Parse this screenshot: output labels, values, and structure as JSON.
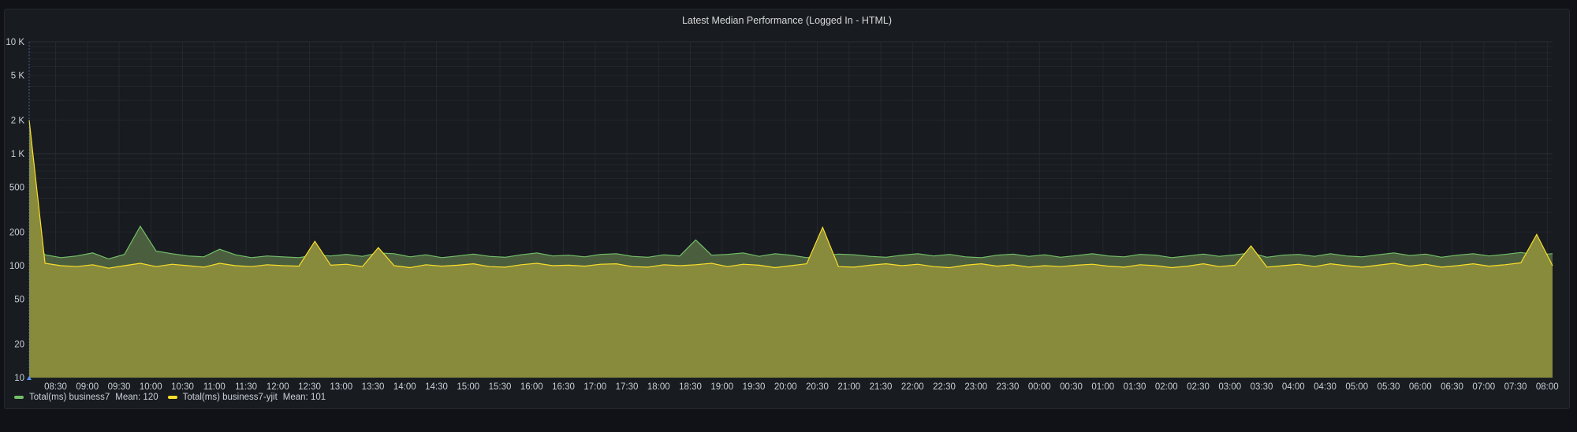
{
  "panel": {
    "title": "Latest Median Performance (Logged In - HTML)"
  },
  "chart_data": {
    "type": "area",
    "title": "Latest Median Performance (Logged In - HTML)",
    "y_scale": "log",
    "ylim": [
      10,
      10000
    ],
    "y_ticks": [
      10,
      20,
      50,
      100,
      200,
      500,
      1000,
      2000,
      5000,
      10000
    ],
    "y_tick_labels": [
      "10",
      "20",
      "50",
      "100",
      "200",
      "500",
      "1 K",
      "2 K",
      "5 K",
      "10 K"
    ],
    "xlim": [
      "08:05",
      "08:05"
    ],
    "x_tick_labels": [
      "08:30",
      "09:00",
      "09:30",
      "10:00",
      "10:30",
      "11:00",
      "11:30",
      "12:00",
      "12:30",
      "13:00",
      "13:30",
      "14:00",
      "14:30",
      "15:00",
      "15:30",
      "16:00",
      "16:30",
      "17:00",
      "17:30",
      "18:00",
      "18:30",
      "19:00",
      "19:30",
      "20:00",
      "20:30",
      "21:00",
      "21:30",
      "22:00",
      "22:30",
      "23:00",
      "23:30",
      "00:00",
      "00:30",
      "01:00",
      "01:30",
      "02:00",
      "02:30",
      "03:00",
      "03:30",
      "04:00",
      "04:30",
      "05:00",
      "05:30",
      "06:00",
      "06:30",
      "07:00",
      "07:30",
      "08:00"
    ],
    "grid": true,
    "legend_placement": "bottom-left",
    "x": [
      "08:05",
      "08:20",
      "08:35",
      "08:50",
      "09:05",
      "09:20",
      "09:35",
      "09:50",
      "10:05",
      "10:20",
      "10:35",
      "10:50",
      "11:05",
      "11:20",
      "11:35",
      "11:50",
      "12:05",
      "12:20",
      "12:35",
      "12:50",
      "13:05",
      "13:20",
      "13:35",
      "13:50",
      "14:05",
      "14:20",
      "14:35",
      "14:50",
      "15:05",
      "15:20",
      "15:35",
      "15:50",
      "16:05",
      "16:20",
      "16:35",
      "16:50",
      "17:05",
      "17:20",
      "17:35",
      "17:50",
      "18:05",
      "18:20",
      "18:35",
      "18:50",
      "19:05",
      "19:20",
      "19:35",
      "19:50",
      "20:05",
      "20:20",
      "20:35",
      "20:50",
      "21:05",
      "21:20",
      "21:35",
      "21:50",
      "22:05",
      "22:20",
      "22:35",
      "22:50",
      "23:05",
      "23:20",
      "23:35",
      "23:50",
      "00:05",
      "00:20",
      "00:35",
      "00:50",
      "01:05",
      "01:20",
      "01:35",
      "01:50",
      "02:05",
      "02:20",
      "02:35",
      "02:50",
      "03:05",
      "03:20",
      "03:35",
      "03:50",
      "04:05",
      "04:20",
      "04:35",
      "04:50",
      "05:05",
      "05:20",
      "05:35",
      "05:50",
      "06:05",
      "06:20",
      "06:35",
      "06:50",
      "07:05",
      "07:20",
      "07:35",
      "07:50",
      "08:05"
    ],
    "series": [
      {
        "name": "Total(ms) business7",
        "mean_label": "Mean: 120",
        "color": "#73bf69",
        "fill": "#4b5f3e",
        "values": [
          180,
          125,
          118,
          122,
          130,
          115,
          126,
          225,
          135,
          128,
          122,
          120,
          140,
          125,
          118,
          122,
          120,
          118,
          124,
          122,
          126,
          121,
          130,
          128,
          120,
          125,
          118,
          122,
          127,
          121,
          119,
          125,
          130,
          122,
          124,
          120,
          126,
          128,
          121,
          119,
          125,
          122,
          170,
          124,
          126,
          130,
          121,
          128,
          124,
          118,
          123,
          127,
          125,
          121,
          119,
          124,
          128,
          122,
          126,
          120,
          118,
          124,
          127,
          121,
          125,
          119,
          123,
          128,
          122,
          120,
          126,
          124,
          118,
          122,
          127,
          121,
          125,
          130,
          119,
          124,
          126,
          121,
          128,
          122,
          120,
          125,
          130,
          123,
          127,
          119,
          124,
          128,
          122,
          126,
          131,
          125,
          128
        ]
      },
      {
        "name": "Total(ms) business7-yjit",
        "mean_label": "Mean: 101",
        "color": "#fade2a",
        "fill": "#888a3c",
        "values": [
          2000,
          105,
          100,
          98,
          102,
          95,
          100,
          105,
          98,
          103,
          100,
          97,
          105,
          100,
          98,
          102,
          100,
          99,
          165,
          101,
          103,
          98,
          145,
          100,
          96,
          102,
          99,
          101,
          104,
          98,
          97,
          102,
          105,
          100,
          101,
          99,
          103,
          104,
          98,
          97,
          102,
          100,
          102,
          105,
          98,
          103,
          101,
          96,
          100,
          104,
          220,
          98,
          97,
          101,
          104,
          100,
          103,
          98,
          96,
          101,
          104,
          99,
          102,
          97,
          100,
          98,
          101,
          103,
          99,
          97,
          102,
          100,
          96,
          99,
          104,
          98,
          101,
          150,
          97,
          100,
          103,
          98,
          104,
          100,
          97,
          101,
          105,
          99,
          103,
          97,
          100,
          104,
          99,
          102,
          106,
          190,
          100
        ]
      }
    ]
  }
}
